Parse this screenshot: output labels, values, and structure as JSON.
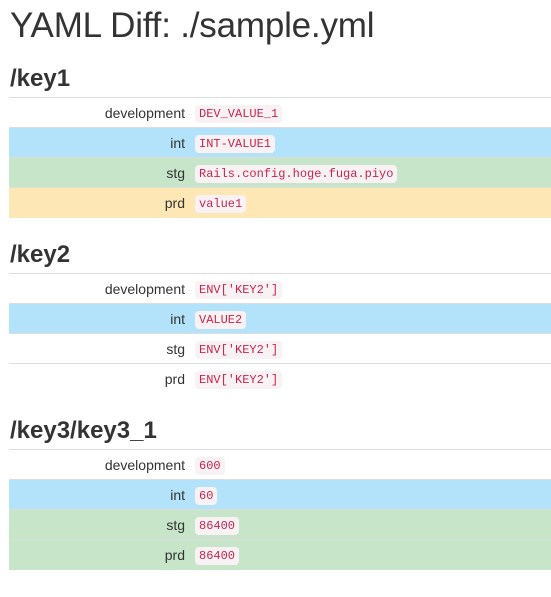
{
  "title": "YAML Diff: ./sample.yml",
  "sections": [
    {
      "key": "/key1",
      "rows": [
        {
          "env": "development",
          "value": "DEV_VALUE_1",
          "status": "none"
        },
        {
          "env": "int",
          "value": "INT-VALUE1",
          "status": "info"
        },
        {
          "env": "stg",
          "value": "Rails.config.hoge.fuga.piyo",
          "status": "success"
        },
        {
          "env": "prd",
          "value": "value1",
          "status": "warning"
        }
      ]
    },
    {
      "key": "/key2",
      "rows": [
        {
          "env": "development",
          "value": "ENV['KEY2']",
          "status": "none"
        },
        {
          "env": "int",
          "value": "VALUE2",
          "status": "info"
        },
        {
          "env": "stg",
          "value": "ENV['KEY2']",
          "status": "none"
        },
        {
          "env": "prd",
          "value": "ENV['KEY2']",
          "status": "none"
        }
      ]
    },
    {
      "key": "/key3/key3_1",
      "rows": [
        {
          "env": "development",
          "value": "600",
          "status": "none"
        },
        {
          "env": "int",
          "value": "60",
          "status": "info"
        },
        {
          "env": "stg",
          "value": "86400",
          "status": "success"
        },
        {
          "env": "prd",
          "value": "86400",
          "status": "success"
        }
      ]
    }
  ],
  "colors": {
    "info": "#b3e3fb",
    "success": "#c7e6c9",
    "warning": "#fde7b4",
    "code_text": "#c7254e",
    "code_bg": "#f9f2f4"
  }
}
